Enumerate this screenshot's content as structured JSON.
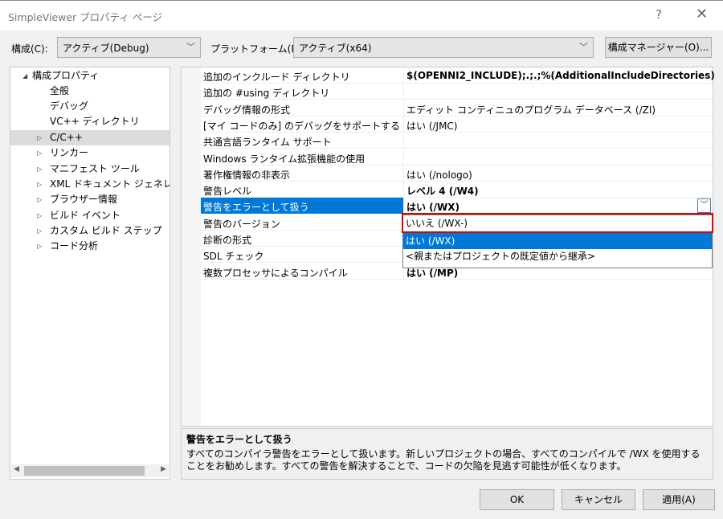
{
  "window": {
    "title": "SimpleViewer プロパティ ページ",
    "help": "?",
    "close": "✕"
  },
  "toolbar": {
    "config_label": "構成(C):",
    "config_value": "アクティブ(Debug)",
    "platform_label": "プラットフォーム(P):",
    "platform_value": "アクティブ(x64)",
    "config_manager": "構成マネージャー(O)..."
  },
  "tree": {
    "root": "構成プロパティ",
    "children": [
      "全般",
      "デバッグ",
      "VC++ ディレクトリ"
    ],
    "expandables": [
      "C/C++",
      "リンカー",
      "マニフェスト ツール",
      "XML ドキュメント ジェネレーター",
      "ブラウザー情報",
      "ビルド イベント",
      "カスタム ビルド ステップ",
      "コード分析"
    ]
  },
  "grid": {
    "rows": [
      {
        "name": "追加のインクルード ディレクトリ",
        "value": "$(OPENNI2_INCLUDE);.;.;%(AdditionalIncludeDirectories)"
      },
      {
        "name": "追加の #using ディレクトリ",
        "value": ""
      },
      {
        "name": "デバッグ情報の形式",
        "value": "エディット コンティニュのプログラム データベース (/ZI)"
      },
      {
        "name": "[マイ コードのみ] のデバッグをサポートする",
        "value": "はい (/JMC)"
      },
      {
        "name": "共通言語ランタイム サポート",
        "value": ""
      },
      {
        "name": "Windows ランタイム拡張機能の使用",
        "value": ""
      },
      {
        "name": "著作権情報の非表示",
        "value": "はい (/nologo)"
      },
      {
        "name": "警告レベル",
        "value": "レベル 4 (/W4)"
      },
      {
        "name": "警告をエラーとして扱う",
        "value": "はい (/WX)"
      },
      {
        "name": "警告のバージョン",
        "value": ""
      },
      {
        "name": "診断の形式",
        "value": ""
      },
      {
        "name": "SDL チェック",
        "value": ""
      },
      {
        "name": "複数プロセッサによるコンパイル",
        "value": "はい (/MP)"
      }
    ]
  },
  "dropdown": {
    "options": [
      "いいえ (/WX-)",
      "はい (/WX)",
      "<親またはプロジェクトの既定値から継承>"
    ],
    "selected": "はい (/WX)",
    "highlight_color": "#e00000"
  },
  "description": {
    "title": "警告をエラーとして扱う",
    "body": "すべてのコンパイラ警告をエラーとして扱います。新しいプロジェクトの場合、すべてのコンパイルで /WX を使用することをお勧めします。すべての警告を解決することで、コードの欠陥を見逃す可能性が低くなります。"
  },
  "buttons": {
    "ok": "OK",
    "cancel": "キャンセル",
    "apply": "適用(A)"
  }
}
